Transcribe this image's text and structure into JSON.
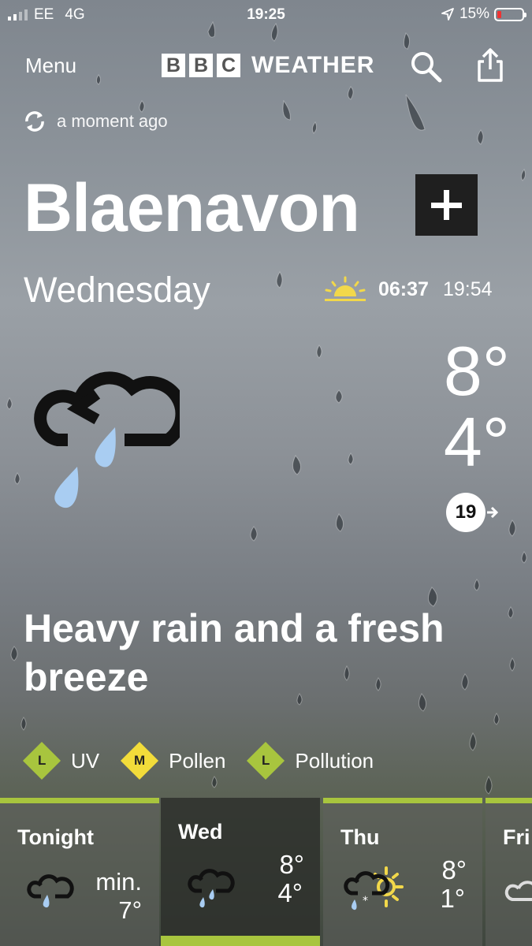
{
  "status_bar": {
    "carrier": "EE",
    "network": "4G",
    "time": "19:25",
    "battery": "15%"
  },
  "header": {
    "menu_label": "Menu",
    "logo_letters": [
      "B",
      "B",
      "C"
    ],
    "logo_text": "WEATHER",
    "search_icon": "search-icon",
    "share_icon": "share-icon"
  },
  "refresh": {
    "icon": "refresh-icon",
    "label": "a moment ago"
  },
  "location": {
    "name": "Blaenavon",
    "add_icon": "plus-icon"
  },
  "today": {
    "day": "Wednesday",
    "sunrise": "06:37",
    "sunset": "19:54",
    "max_temp": "8°",
    "min_temp": "4°",
    "wind_speed": "19",
    "weather_icon": "heavy-rain-icon",
    "summary": "Heavy rain and a fresh breeze"
  },
  "indicators": [
    {
      "level": "L",
      "label": "UV",
      "color": "#a8c53e"
    },
    {
      "level": "M",
      "label": "Pollen",
      "color": "#f2dc3a"
    },
    {
      "level": "L",
      "label": "Pollution",
      "color": "#a8c53e"
    }
  ],
  "forecast": [
    {
      "name": "Tonight",
      "min_label": "min.",
      "low": "7°",
      "icon": "light-rain-icon"
    },
    {
      "name": "Wed",
      "high": "8°",
      "low": "4°",
      "icon": "heavy-rain-icon"
    },
    {
      "name": "Thu",
      "high": "8°",
      "low": "1°",
      "icon": "sleet-sun-icon"
    },
    {
      "name": "Fri",
      "icon": "cloud-icon"
    }
  ],
  "colors": {
    "accent": "#a8c53e",
    "sun": "#f2d84a",
    "raindrop": "#a9cdf2",
    "dark_button": "#1f1f1f"
  }
}
